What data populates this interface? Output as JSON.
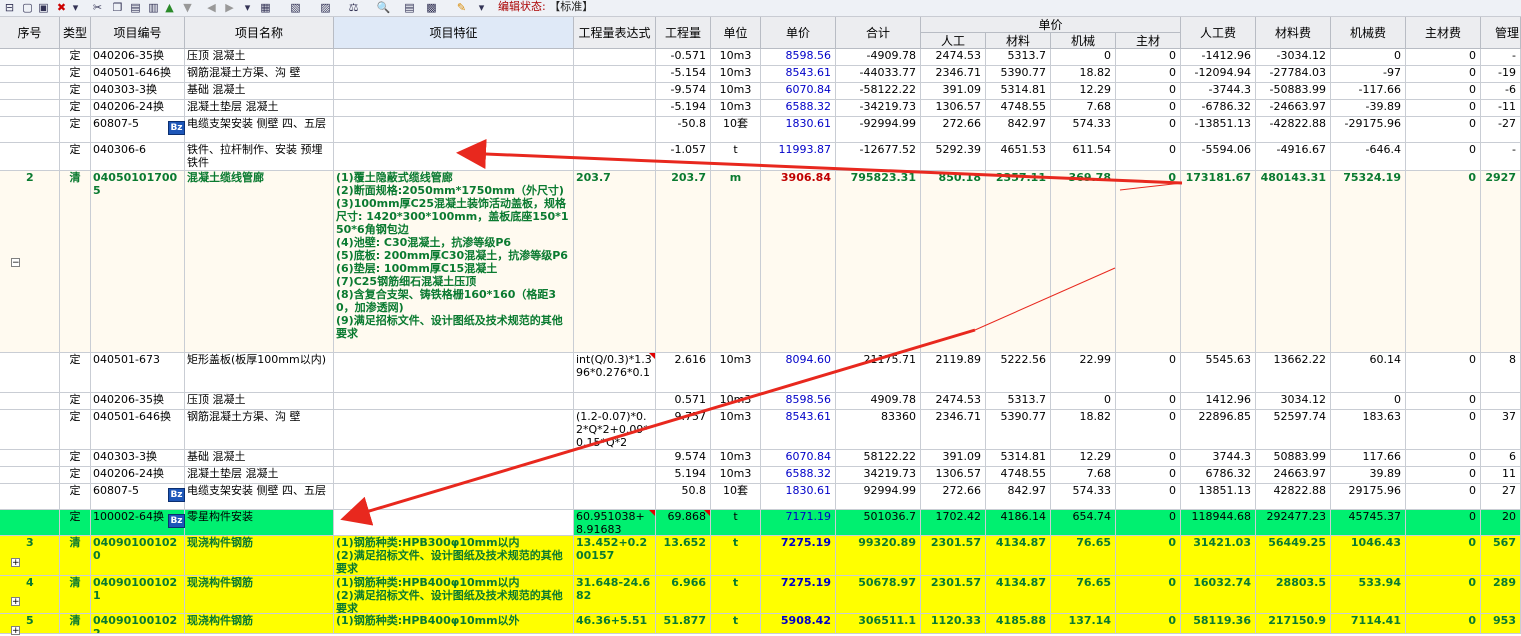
{
  "toolbar": {
    "status_label": "编辑状态:",
    "status_value": "【标准】"
  },
  "header": {
    "seq": "序号",
    "type": "类型",
    "code": "项目编号",
    "name": "项目名称",
    "feature": "项目特征",
    "expr": "工程量表达式",
    "qty": "工程量",
    "unit": "单位",
    "unit_price": "单价",
    "sum": "合计",
    "unit_price_group": "单价",
    "labor": "人工",
    "material": "材料",
    "machine": "机械",
    "main_material": "主材",
    "labor_fee": "人工费",
    "material_fee": "材料费",
    "machine_fee": "机械费",
    "main_fee": "主材费",
    "mgmt_fee": "管理"
  },
  "rows": [
    {
      "seq": "",
      "type": "定",
      "code": "040206-35换",
      "name": "压顶 混凝土",
      "bz": false,
      "feature": "",
      "expr": "",
      "qty": "-0.571",
      "unit": "10m3",
      "price": "8598.56",
      "sum": "-4909.78",
      "lab": "2474.53",
      "mat": "5313.7",
      "mach": "0",
      "main": "0",
      "lf": "-1412.96",
      "mf": "-3034.12",
      "mcf": "0",
      "mmf": "0",
      "mg": "-"
    },
    {
      "seq": "",
      "type": "定",
      "code": "040501-646换",
      "name": "钢筋混凝土方渠、沟 壁",
      "bz": false,
      "feature": "",
      "expr": "",
      "qty": "-5.154",
      "unit": "10m3",
      "price": "8543.61",
      "sum": "-44033.77",
      "lab": "2346.71",
      "mat": "5390.77",
      "mach": "18.82",
      "main": "0",
      "lf": "-12094.94",
      "mf": "-27784.03",
      "mcf": "-97",
      "mmf": "0",
      "mg": "-19"
    },
    {
      "seq": "",
      "type": "定",
      "code": "040303-3换",
      "name": "基础 混凝土",
      "bz": false,
      "feature": "",
      "expr": "",
      "qty": "-9.574",
      "unit": "10m3",
      "price": "6070.84",
      "sum": "-58122.22",
      "lab": "391.09",
      "mat": "5314.81",
      "mach": "12.29",
      "main": "0",
      "lf": "-3744.3",
      "mf": "-50883.99",
      "mcf": "-117.66",
      "mmf": "0",
      "mg": "-6"
    },
    {
      "seq": "",
      "type": "定",
      "code": "040206-24换",
      "name": "混凝土垫层 混凝土",
      "bz": false,
      "feature": "",
      "expr": "",
      "qty": "-5.194",
      "unit": "10m3",
      "price": "6588.32",
      "sum": "-34219.73",
      "lab": "1306.57",
      "mat": "4748.55",
      "mach": "7.68",
      "main": "0",
      "lf": "-6786.32",
      "mf": "-24663.97",
      "mcf": "-39.89",
      "mmf": "0",
      "mg": "-11"
    },
    {
      "seq": "",
      "type": "定",
      "code": "60807-5",
      "name": "电缆支架安装 侧壁 四、五层",
      "bz": true,
      "feature": "",
      "expr": "",
      "qty": "-50.8",
      "unit": "10套",
      "price": "1830.61",
      "sum": "-92994.99",
      "lab": "272.66",
      "mat": "842.97",
      "mach": "574.33",
      "main": "0",
      "lf": "-13851.13",
      "mf": "-42822.88",
      "mcf": "-29175.96",
      "mmf": "0",
      "mg": "-27"
    },
    {
      "seq": "",
      "type": "定",
      "code": "040306-6",
      "name": "铁件、拉杆制作、安装 预埋铁件",
      "bz": false,
      "feature": "",
      "expr": "",
      "qty": "-1.057",
      "unit": "t",
      "price": "11993.87",
      "sum": "-12677.52",
      "lab": "5292.39",
      "mat": "4651.53",
      "mach": "611.54",
      "main": "0",
      "lf": "-5594.06",
      "mf": "-4916.67",
      "mcf": "-646.4",
      "mmf": "0",
      "mg": "-"
    },
    {
      "seq": "2",
      "type": "清",
      "code": "040501017005",
      "name": "混凝土缆线管廊",
      "bz": false,
      "feature": "(1)覆土隐蔽式缆线管廊\n(2)断面规格:2050mm*1750mm（外尺寸)\n(3)100mm厚C25混凝土装饰活动盖板，规格尺寸: 1420*300*100mm，盖板底座150*150*6角钢包边\n(4)池壁: C30混凝土，抗渗等级P6\n(5)底板: 200mm厚C30混凝土，抗渗等级P6\n(6)垫层: 100mm厚C15混凝土\n(7)C25钢筋细石混凝土压顶\n(8)含复合支架、铸铁格栅160*160（格距30，加渗透网)\n(9)满足招标文件、设计图纸及技术规范的其他要求",
      "expr": "203.7",
      "qty": "203.7",
      "unit": "m",
      "price": "3906.84",
      "sum": "795823.31",
      "lab": "850.18",
      "mat": "2357.11",
      "mach": "369.78",
      "main": "0",
      "lf": "173181.67",
      "mf": "480143.31",
      "mcf": "75324.19",
      "mmf": "0",
      "mg": "2927"
    },
    {
      "seq": "",
      "type": "定",
      "code": "040501-673",
      "name": "矩形盖板(板厚100mm以内)",
      "bz": false,
      "feature": "",
      "expr": "int(Q/0.3)*1.396*0.276*0.1",
      "qty": "2.616",
      "unit": "10m3",
      "price": "8094.60",
      "sum": "21175.71",
      "lab": "2119.89",
      "mat": "5222.56",
      "mach": "22.99",
      "main": "0",
      "lf": "5545.63",
      "mf": "13662.22",
      "mcf": "60.14",
      "mmf": "0",
      "mg": "8"
    },
    {
      "seq": "",
      "type": "定",
      "code": "040206-35换",
      "name": "压顶 混凝土",
      "bz": false,
      "feature": "",
      "expr": "",
      "qty": "0.571",
      "unit": "10m3",
      "price": "8598.56",
      "sum": "4909.78",
      "lab": "2474.53",
      "mat": "5313.7",
      "mach": "0",
      "main": "0",
      "lf": "1412.96",
      "mf": "3034.12",
      "mcf": "0",
      "mmf": "0",
      "mg": ""
    },
    {
      "seq": "",
      "type": "定",
      "code": "040501-646换",
      "name": "钢筋混凝土方渠、沟 壁",
      "bz": false,
      "feature": "",
      "expr": "(1.2-0.07)*0.2*Q*2+0.09*0.15*Q*2",
      "qty": "9.757",
      "unit": "10m3",
      "price": "8543.61",
      "sum": "83360",
      "lab": "2346.71",
      "mat": "5390.77",
      "mach": "18.82",
      "main": "0",
      "lf": "22896.85",
      "mf": "52597.74",
      "mcf": "183.63",
      "mmf": "0",
      "mg": "37"
    },
    {
      "seq": "",
      "type": "定",
      "code": "040303-3换",
      "name": "基础 混凝土",
      "bz": false,
      "feature": "",
      "expr": "",
      "qty": "9.574",
      "unit": "10m3",
      "price": "6070.84",
      "sum": "58122.22",
      "lab": "391.09",
      "mat": "5314.81",
      "mach": "12.29",
      "main": "0",
      "lf": "3744.3",
      "mf": "50883.99",
      "mcf": "117.66",
      "mmf": "0",
      "mg": "6"
    },
    {
      "seq": "",
      "type": "定",
      "code": "040206-24换",
      "name": "混凝土垫层 混凝土",
      "bz": false,
      "feature": "",
      "expr": "",
      "qty": "5.194",
      "unit": "10m3",
      "price": "6588.32",
      "sum": "34219.73",
      "lab": "1306.57",
      "mat": "4748.55",
      "mach": "7.68",
      "main": "0",
      "lf": "6786.32",
      "mf": "24663.97",
      "mcf": "39.89",
      "mmf": "0",
      "mg": "11"
    },
    {
      "seq": "",
      "type": "定",
      "code": "60807-5",
      "name": "电缆支架安装 侧壁 四、五层",
      "bz": true,
      "feature": "",
      "expr": "",
      "qty": "50.8",
      "unit": "10套",
      "price": "1830.61",
      "sum": "92994.99",
      "lab": "272.66",
      "mat": "842.97",
      "mach": "574.33",
      "main": "0",
      "lf": "13851.13",
      "mf": "42822.88",
      "mcf": "29175.96",
      "mmf": "0",
      "mg": "27"
    },
    {
      "seq": "",
      "type": "定",
      "code": "100002-64换",
      "name": "零星构件安装",
      "bz": true,
      "feature": "",
      "expr": "60.951038+8.91683",
      "qty": "69.868",
      "unit": "t",
      "price": "7171.19",
      "sum": "501036.7",
      "lab": "1702.42",
      "mat": "4186.14",
      "mach": "654.74",
      "main": "0",
      "lf": "118944.68",
      "mf": "292477.23",
      "mcf": "45745.37",
      "mmf": "0",
      "mg": "20"
    },
    {
      "seq": "3",
      "type": "清",
      "code": "040901001020",
      "name": "现浇构件钢筋",
      "bz": false,
      "feature": "(1)钢筋种类:HPB300φ10mm以内\n(2)满足招标文件、设计图纸及技术规范的其他要求",
      "expr": "13.452+0.200157",
      "qty": "13.652",
      "unit": "t",
      "price": "7275.19",
      "sum": "99320.89",
      "lab": "2301.57",
      "mat": "4134.87",
      "mach": "76.65",
      "main": "0",
      "lf": "31421.03",
      "mf": "56449.25",
      "mcf": "1046.43",
      "mmf": "0",
      "mg": "567"
    },
    {
      "seq": "4",
      "type": "清",
      "code": "040901001021",
      "name": "现浇构件钢筋",
      "bz": false,
      "feature": "(1)钢筋种类:HPB400φ10mm以内\n(2)满足招标文件、设计图纸及技术规范的其他要求",
      "expr": "31.648-24.682",
      "qty": "6.966",
      "unit": "t",
      "price": "7275.19",
      "sum": "50678.97",
      "lab": "2301.57",
      "mat": "4134.87",
      "mach": "76.65",
      "main": "0",
      "lf": "16032.74",
      "mf": "28803.5",
      "mcf": "533.94",
      "mmf": "0",
      "mg": "289"
    },
    {
      "seq": "5",
      "type": "清",
      "code": "040901001022",
      "name": "现浇构件钢筋",
      "bz": false,
      "feature": "(1)钢筋种类:HPB400φ10mm以外",
      "expr": "46.36+5.51",
      "qty": "51.877",
      "unit": "t",
      "price": "5908.42",
      "sum": "306511.1",
      "lab": "1120.33",
      "mat": "4185.88",
      "mach": "137.14",
      "main": "0",
      "lf": "58119.36",
      "mf": "217150.9",
      "mcf": "7114.41",
      "mmf": "0",
      "mg": "953"
    }
  ],
  "colors": {
    "list_row_bg": "#fffaf0",
    "selected_row_bg": "#00f070",
    "yellow_row_bg": "#ffff00",
    "arrow": "#e8281e"
  }
}
